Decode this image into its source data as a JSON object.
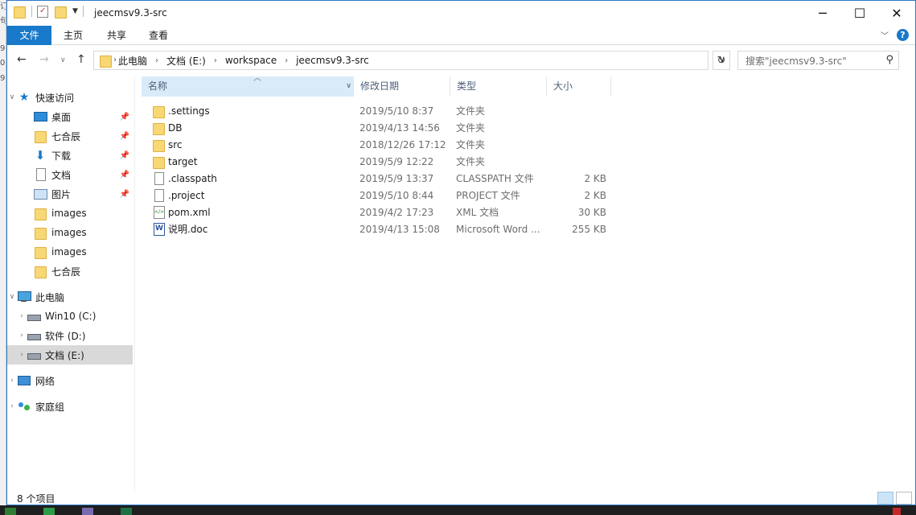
{
  "window": {
    "title": "jeecmsv9.3-src"
  },
  "ribbon": {
    "tabs": [
      "文件",
      "主页",
      "共享",
      "查看"
    ]
  },
  "address": {
    "crumbs": [
      "此电脑",
      "文档 (E:)",
      "workspace",
      "jeecmsv9.3-src"
    ],
    "search_placeholder": "搜索\"jeecmsv9.3-src\""
  },
  "nav": {
    "quick_access": "快速访问",
    "pinned": [
      {
        "label": "桌面",
        "icon": "desktop-icon"
      },
      {
        "label": "七合辰",
        "icon": "folder-icon"
      },
      {
        "label": "下载",
        "icon": "download-icon"
      },
      {
        "label": "文档",
        "icon": "document-icon"
      },
      {
        "label": "图片",
        "icon": "pictures-icon"
      },
      {
        "label": "images",
        "icon": "folder-icon"
      },
      {
        "label": "images",
        "icon": "folder-icon"
      },
      {
        "label": "images",
        "icon": "folder-icon"
      },
      {
        "label": "七合辰",
        "icon": "folder-icon"
      }
    ],
    "this_pc": "此电脑",
    "drives": [
      {
        "label": "Win10 (C:)"
      },
      {
        "label": "软件 (D:)"
      },
      {
        "label": "文档 (E:)"
      }
    ],
    "network": "网络",
    "homegroup": "家庭组"
  },
  "columns": {
    "name": "名称",
    "date": "修改日期",
    "type": "类型",
    "size": "大小"
  },
  "files": [
    {
      "name": ".settings",
      "date": "2019/5/10 8:37",
      "type": "文件夹",
      "size": "",
      "icon": "folder-icon"
    },
    {
      "name": "DB",
      "date": "2019/4/13 14:56",
      "type": "文件夹",
      "size": "",
      "icon": "folder-icon"
    },
    {
      "name": "src",
      "date": "2018/12/26 17:12",
      "type": "文件夹",
      "size": "",
      "icon": "folder-icon"
    },
    {
      "name": "target",
      "date": "2019/5/9 12:22",
      "type": "文件夹",
      "size": "",
      "icon": "folder-icon"
    },
    {
      "name": ".classpath",
      "date": "2019/5/9 13:37",
      "type": "CLASSPATH 文件",
      "size": "2 KB",
      "icon": "file-icon"
    },
    {
      "name": ".project",
      "date": "2019/5/10 8:44",
      "type": "PROJECT 文件",
      "size": "2 KB",
      "icon": "file-icon"
    },
    {
      "name": "pom.xml",
      "date": "2019/4/2 17:23",
      "type": "XML 文档",
      "size": "30 KB",
      "icon": "xml-icon"
    },
    {
      "name": "说明.doc",
      "date": "2019/4/13 15:08",
      "type": "Microsoft Word ...",
      "size": "255 KB",
      "icon": "word-doc-icon"
    }
  ],
  "status": {
    "item_count": "8 个项目"
  },
  "colors": {
    "accent": "#1979ca",
    "selected_header": "#d9ebf9",
    "folder": "#f8d775"
  }
}
